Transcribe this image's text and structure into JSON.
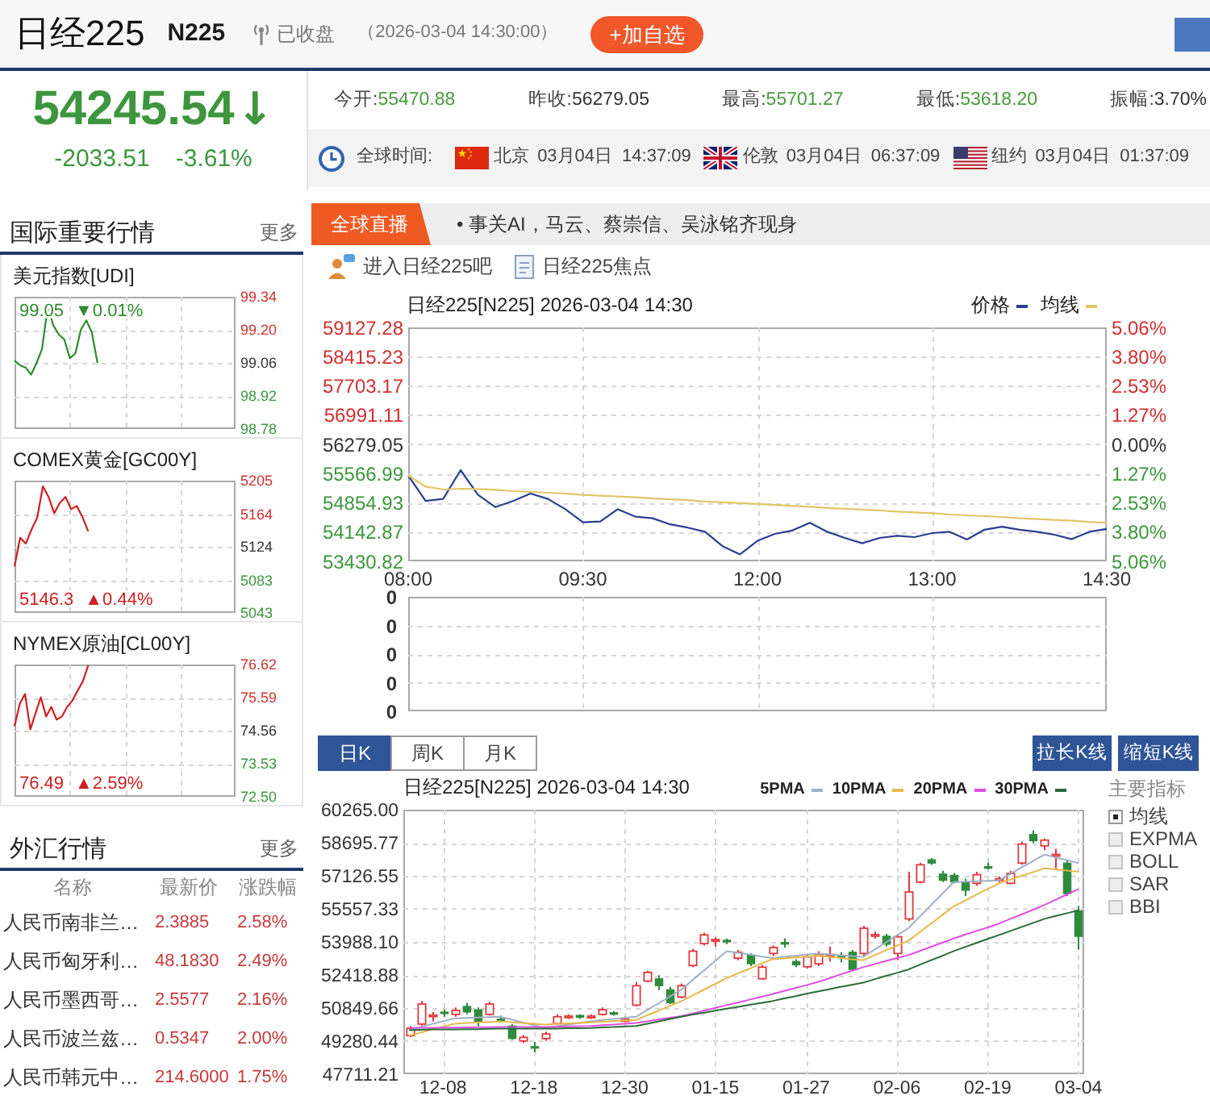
{
  "header": {
    "title": "日经225",
    "code": "N225",
    "status": "已收盘",
    "time": "（2026-03-04 14:30:00）",
    "add_button": "+加自选"
  },
  "quote": {
    "price": "54245.54",
    "arrow": "↓",
    "change": "-2033.51",
    "change_percent": "-3.61%"
  },
  "stats": [
    {
      "label": "今开:",
      "value": "55470.88",
      "color": "#4a9a3e"
    },
    {
      "label": "昨收:",
      "value": "56279.05",
      "color": "#333333"
    },
    {
      "label": "最高:",
      "value": "55701.27",
      "color": "#4a9a3e"
    },
    {
      "label": "最低:",
      "value": "53618.20",
      "color": "#4a9a3e"
    },
    {
      "label": "振幅:",
      "value": "3.70%",
      "color": "#333333"
    }
  ],
  "world_time": {
    "label": "全球时间:",
    "cities": [
      {
        "kind": "cn",
        "city": "北京",
        "date": "03月04日",
        "time": "14:37:09"
      },
      {
        "kind": "gb",
        "city": "伦敦",
        "date": "03月04日",
        "time": "06:37:09"
      },
      {
        "kind": "us",
        "city": "纽约",
        "date": "03月04日",
        "time": "01:37:09"
      }
    ]
  },
  "sidebar": {
    "markets": {
      "title": "国际重要行情",
      "more": "更多",
      "items": [
        {
          "name": "美元指数[UDI]",
          "price": "99.05",
          "change": "▼0.01%",
          "chart_data": {
            "type": "line",
            "grid": true,
            "categories": [
              null,
              null,
              null,
              null,
              null,
              null,
              null,
              null,
              null,
              null,
              null,
              null,
              null,
              null,
              null,
              null,
              null,
              null,
              null,
              null,
              null,
              null,
              null,
              null,
              null,
              null,
              null,
              null,
              null,
              null,
              null,
              null,
              null,
              null,
              null,
              null,
              null,
              null,
              null,
              null,
              null
            ],
            "ylim": [
              98.78,
              99.34
            ],
            "yticks": [
              {
                "value": 99.34,
                "label": "99.34"
              },
              {
                "value": 99.2,
                "label": "99.20"
              },
              {
                "value": 99.06,
                "label": "99.06"
              },
              {
                "value": 98.92,
                "label": "98.92"
              },
              {
                "value": 98.78,
                "label": "98.78"
              }
            ],
            "series": [
              {
                "color": "#2e8b2e",
                "values": [
                  99.07,
                  99.05,
                  99.04,
                  99.01,
                  99.06,
                  99.12,
                  99.3,
                  99.22,
                  99.18,
                  99.16,
                  99.08,
                  99.1,
                  99.2,
                  99.24,
                  99.19,
                  99.06,
                  null,
                  null,
                  null,
                  null,
                  null,
                  null,
                  null,
                  null,
                  null,
                  null,
                  null,
                  null,
                  null,
                  null,
                  null,
                  null,
                  null,
                  null,
                  null,
                  null,
                  null,
                  null,
                  null,
                  null,
                  null
                ]
              }
            ]
          }
        },
        {
          "name": "COMEX黄金[GC00Y]",
          "price": "5146.3",
          "change": "▲0.44%",
          "chart_data": {
            "type": "line",
            "grid": true,
            "categories": [
              null,
              null,
              null,
              null,
              null,
              null,
              null,
              null,
              null,
              null,
              null,
              null,
              null,
              null,
              null,
              null,
              null,
              null,
              null,
              null,
              null,
              null,
              null,
              null,
              null,
              null,
              null,
              null,
              null,
              null,
              null,
              null,
              null,
              null,
              null,
              null,
              null,
              null,
              null,
              null
            ],
            "ylim": [
              5043,
              5205
            ],
            "yticks": [
              {
                "value": 5205,
                "label": "5205"
              },
              {
                "value": 5164,
                "label": "5164"
              },
              {
                "value": 5124,
                "label": "5124"
              },
              {
                "value": 5083,
                "label": "5083"
              },
              {
                "value": 5043,
                "label": "5043"
              }
            ],
            "series": [
              {
                "color": "#cc2020",
                "values": [
                  5100,
                  5135,
                  5128,
                  5145,
                  5160,
                  5198,
                  5185,
                  5165,
                  5178,
                  5185,
                  5170,
                  5174,
                  5160,
                  5143,
                  null,
                  null,
                  null,
                  null,
                  null,
                  null,
                  null,
                  null,
                  null,
                  null,
                  null,
                  null,
                  null,
                  null,
                  null,
                  null,
                  null,
                  null,
                  null,
                  null,
                  null,
                  null,
                  null,
                  null,
                  null,
                  null
                ]
              }
            ]
          }
        },
        {
          "name": "NYMEX原油[CL00Y]",
          "price": "76.49",
          "change": "▲2.59%",
          "chart_data": {
            "type": "line",
            "grid": true,
            "categories": [
              null,
              null,
              null,
              null,
              null,
              null,
              null,
              null,
              null,
              null,
              null,
              null,
              null,
              null,
              null,
              null,
              null,
              null,
              null,
              null,
              null,
              null,
              null,
              null,
              null,
              null,
              null,
              null,
              null,
              null,
              null,
              null,
              null,
              null,
              null,
              null,
              null,
              null,
              null,
              null,
              null,
              null,
              null
            ],
            "ylim": [
              72.5,
              76.62
            ],
            "yticks": [
              {
                "value": 76.62,
                "label": "76.62"
              },
              {
                "value": 75.59,
                "label": "75.59"
              },
              {
                "value": 74.56,
                "label": "74.56"
              },
              {
                "value": 73.53,
                "label": "73.53"
              },
              {
                "value": 72.5,
                "label": "72.50"
              }
            ],
            "series": [
              {
                "color": "#cc2020",
                "values": [
                  74.7,
                  75.4,
                  75.7,
                  74.6,
                  75.1,
                  75.6,
                  75,
                  75.3,
                  74.9,
                  75,
                  75.3,
                  75.5,
                  75.8,
                  76.1,
                  76.6,
                  null,
                  null,
                  null,
                  null,
                  null,
                  null,
                  null,
                  null,
                  null,
                  null,
                  null,
                  null,
                  null,
                  null,
                  null,
                  null,
                  null,
                  null,
                  null,
                  null,
                  null,
                  null,
                  null,
                  null,
                  null,
                  null,
                  null,
                  null
                ]
              }
            ]
          }
        }
      ]
    },
    "forex": {
      "title": "外汇行情",
      "more": "更多",
      "columns": [
        "名称",
        "最新价",
        "涨跌幅"
      ],
      "rows": [
        {
          "name": "人民币南非兰…",
          "price": "2.3885",
          "change": "2.58%"
        },
        {
          "name": "人民币匈牙利…",
          "price": "48.1830",
          "change": "2.49%"
        },
        {
          "name": "人民币墨西哥…",
          "price": "2.5577",
          "change": "2.16%"
        },
        {
          "name": "人民币波兰兹…",
          "price": "0.5347",
          "change": "2.00%"
        },
        {
          "name": "人民币韩元中…",
          "price": "214.6000",
          "change": "1.75%"
        }
      ]
    }
  },
  "main": {
    "news": {
      "tab": "全球直播",
      "headline": "• 事关AI，马云、蔡崇信、吴泳铭齐现身"
    },
    "links": [
      {
        "kind": "forum",
        "label": "进入日经225吧"
      },
      {
        "kind": "focus",
        "label": "日经225焦点"
      }
    ],
    "intraday": {
      "chart_data": {
        "type": "line",
        "title": "日经225[N225] 2026-03-04 14:30",
        "grid": true,
        "legend": "upper right",
        "categories": [
          "08:00",
          null,
          null,
          null,
          null,
          null,
          null,
          null,
          null,
          null,
          "09:30",
          null,
          null,
          null,
          null,
          null,
          null,
          null,
          null,
          null,
          "12:00",
          null,
          null,
          null,
          null,
          null,
          null,
          null,
          null,
          null,
          "13:00",
          null,
          null,
          null,
          null,
          null,
          null,
          null,
          null,
          null,
          "14:30"
        ],
        "ylim": [
          53430.82,
          59127.28
        ],
        "yticks": [
          {
            "value": 59127.28,
            "label": "59127.28"
          },
          {
            "value": 58415.23,
            "label": "58415.23"
          },
          {
            "value": 57703.17,
            "label": "57703.17"
          },
          {
            "value": 56991.11,
            "label": "56991.11"
          },
          {
            "value": 56279.05,
            "label": "56279.05"
          },
          {
            "value": 55566.99,
            "label": "55566.99"
          },
          {
            "value": 54854.93,
            "label": "54854.93"
          },
          {
            "value": 54142.87,
            "label": "54142.87"
          },
          {
            "value": 53430.82,
            "label": "53430.82"
          }
        ],
        "series": [
          {
            "name": "价格",
            "color": "#2b3f8f",
            "values": [
              55520,
              54900,
              54950,
              55650,
              55050,
              54750,
              54900,
              55080,
              54950,
              54700,
              54380,
              54400,
              54700,
              54520,
              54480,
              54330,
              54250,
              54150,
              53800,
              53600,
              53930,
              54100,
              54180,
              54370,
              54150,
              54000,
              53870,
              54000,
              54050,
              54020,
              54120,
              54150,
              53960,
              54200,
              54270,
              54200,
              54150,
              54080,
              53970,
              54150,
              54220
            ]
          },
          {
            "name": "均线",
            "color": "#e3c468",
            "values": [
              55520,
              55250,
              55180,
              55200,
              55190,
              55170,
              55140,
              55120,
              55100,
              55080,
              55050,
              55030,
              55010,
              54990,
              54960,
              54940,
              54920,
              54890,
              54870,
              54850,
              54830,
              54800,
              54780,
              54760,
              54730,
              54710,
              54690,
              54670,
              54640,
              54620,
              54600,
              54570,
              54550,
              54530,
              54510,
              54480,
              54460,
              54440,
              54420,
              54390,
              54370
            ]
          }
        ]
      },
      "percent_labels": [
        "5.06%",
        "3.80%",
        "2.53%",
        "1.27%",
        "0.00%",
        "1.27%",
        "2.53%",
        "3.80%",
        "5.06%"
      ]
    },
    "volume": {
      "y_labels": [
        "0",
        "0",
        "0",
        "0",
        "0"
      ]
    },
    "kline": {
      "tabs": [
        {
          "label": "日K",
          "selected": true
        },
        {
          "label": "周K",
          "selected": false
        },
        {
          "label": "月K",
          "selected": false
        }
      ],
      "buttons": [
        "拉长K线",
        "缩短K线"
      ],
      "chart_data": {
        "type": "candlestick",
        "title": "日经225[N225] 2026-03-04 14:30",
        "grid": true,
        "legend": "upper right",
        "categories": [
          null,
          null,
          null,
          "12-08",
          null,
          null,
          null,
          null,
          null,
          null,
          null,
          "12-18",
          null,
          null,
          null,
          null,
          null,
          null,
          null,
          "12-30",
          null,
          null,
          null,
          null,
          null,
          null,
          null,
          "01-15",
          null,
          null,
          null,
          null,
          null,
          null,
          null,
          "01-27",
          null,
          null,
          null,
          null,
          null,
          null,
          null,
          "02-06",
          null,
          null,
          null,
          null,
          null,
          null,
          null,
          "02-19",
          null,
          null,
          null,
          null,
          null,
          null,
          null,
          "03-04"
        ],
        "ylim": [
          47711.21,
          60265
        ],
        "yticks": [
          {
            "value": 60265,
            "label": "60265.00"
          },
          {
            "value": 58695.77,
            "label": "58695.77"
          },
          {
            "value": 57126.55,
            "label": "57126.55"
          },
          {
            "value": 55557.33,
            "label": "55557.33"
          },
          {
            "value": 53988.1,
            "label": "53988.10"
          },
          {
            "value": 52418.88,
            "label": "52418.88"
          },
          {
            "value": 50849.66,
            "label": "50849.66"
          },
          {
            "value": 49280.44,
            "label": "49280.44"
          },
          {
            "value": 47711.21,
            "label": "47711.21"
          }
        ],
        "ohlc": [
          [
            49540,
            50000,
            49460,
            49890
          ],
          [
            50090,
            51180,
            50000,
            51040
          ],
          [
            50470,
            50660,
            50220,
            50520
          ],
          [
            50660,
            50770,
            50440,
            50600
          ],
          [
            50550,
            50880,
            50440,
            50740
          ],
          [
            50930,
            51100,
            50550,
            50660
          ],
          [
            50770,
            50880,
            50000,
            50220
          ],
          [
            50550,
            51150,
            50500,
            51040
          ],
          [
            50330,
            50500,
            50170,
            50280
          ],
          [
            50000,
            50090,
            49350,
            49400
          ],
          [
            49290,
            49570,
            49190,
            49460
          ],
          [
            49020,
            49240,
            48750,
            48970
          ],
          [
            49400,
            49730,
            49290,
            49620
          ],
          [
            50110,
            50550,
            50060,
            50440
          ],
          [
            50410,
            50550,
            50330,
            50470
          ],
          [
            50500,
            50550,
            50330,
            50410
          ],
          [
            50410,
            50550,
            50330,
            50470
          ],
          [
            50550,
            50880,
            50500,
            50770
          ],
          [
            50630,
            50710,
            50500,
            50550
          ],
          [
            50220,
            50440,
            50170,
            50330
          ],
          [
            50990,
            52080,
            50930,
            51910
          ],
          [
            52130,
            52620,
            52080,
            52540
          ],
          [
            52240,
            52410,
            51700,
            51910
          ],
          [
            51720,
            51860,
            51040,
            51100
          ],
          [
            51370,
            52020,
            51310,
            51910
          ],
          [
            52870,
            53660,
            52790,
            53550
          ],
          [
            53910,
            54430,
            53820,
            54320
          ],
          [
            54040,
            54210,
            53770,
            54100
          ],
          [
            54070,
            54150,
            53880,
            53990
          ],
          [
            53220,
            53610,
            53120,
            53500
          ],
          [
            53360,
            53440,
            52840,
            52950
          ],
          [
            52240,
            52900,
            52190,
            52790
          ],
          [
            53440,
            53820,
            53330,
            53720
          ],
          [
            53960,
            54150,
            53720,
            53910
          ],
          [
            53060,
            53170,
            52790,
            52900
          ],
          [
            52810,
            53390,
            52730,
            53280
          ],
          [
            52950,
            53550,
            52840,
            53390
          ],
          [
            53330,
            53770,
            53060,
            53390
          ],
          [
            53330,
            53500,
            53010,
            53280
          ],
          [
            53500,
            53610,
            52620,
            52680
          ],
          [
            53440,
            54750,
            53330,
            54640
          ],
          [
            54290,
            54480,
            54150,
            54340
          ],
          [
            54260,
            54370,
            53770,
            53880
          ],
          [
            53440,
            54320,
            53120,
            54230
          ],
          [
            55080,
            57320,
            54970,
            56360
          ],
          [
            56830,
            57750,
            56770,
            57650
          ],
          [
            57890,
            57970,
            57650,
            57730
          ],
          [
            57210,
            57370,
            56830,
            56910
          ],
          [
            57150,
            57260,
            56770,
            56830
          ],
          [
            56830,
            56990,
            56170,
            56440
          ],
          [
            56770,
            57320,
            56660,
            57180
          ],
          [
            57560,
            57750,
            57430,
            57510
          ],
          [
            56910,
            57100,
            56830,
            56990
          ],
          [
            56770,
            57370,
            56720,
            57240
          ],
          [
            57730,
            58740,
            57650,
            58630
          ],
          [
            59090,
            59280,
            58680,
            58790
          ],
          [
            58550,
            58900,
            58350,
            58820
          ],
          [
            58080,
            58410,
            57450,
            58140
          ],
          [
            57730,
            57860,
            56170,
            56280
          ],
          [
            55470,
            55700,
            53620,
            54250
          ]
        ],
        "series": [
          {
            "name": "5PMA",
            "type": "line",
            "color": "#9fb0c4",
            "values": [
              49810,
              49950,
              50090,
              50220,
              50360,
              50380,
              50400,
              50420,
              50440,
              50310,
              50170,
              50040,
              49900,
              49980,
              50060,
              50140,
              50220,
              50280,
              50330,
              50390,
              50440,
              50760,
              51080,
              51400,
              51720,
              52180,
              52640,
              53090,
              53550,
              53470,
              53390,
              53300,
              53220,
              53280,
              53330,
              53390,
              53440,
              53400,
              53360,
              53320,
              53280,
              53620,
              53960,
              54300,
              54640,
              55190,
              55740,
              56280,
              56830,
              56850,
              56870,
              56890,
              56910,
              57220,
              57530,
              57830,
              58140,
              58000,
              57870,
              57730
            ]
          },
          {
            "name": "10PMA",
            "type": "line",
            "color": "#e6b84a",
            "values": [
              49540,
              49680,
              49830,
              49970,
              50110,
              50140,
              50170,
              50190,
              50220,
              50180,
              50140,
              50100,
              50060,
              50090,
              50120,
              50140,
              50170,
              50200,
              50230,
              50250,
              50280,
              50510,
              50730,
              50960,
              51180,
              51450,
              51730,
              52000,
              52270,
              52500,
              52720,
              52950,
              53170,
              53210,
              53250,
              53290,
              53330,
              53280,
              53230,
              53170,
              53120,
              53350,
              53580,
              53810,
              54040,
              54450,
              54860,
              55270,
              55680,
              55950,
              56230,
              56500,
              56770,
              56950,
              57130,
              57300,
              57480,
              57430,
              57370,
              57320
            ]
          },
          {
            "name": "20PMA",
            "type": "line",
            "color": "#e04ee0",
            "values": [
              49900,
              49910,
              49910,
              49920,
              49920,
              49930,
              49940,
              49940,
              49950,
              49950,
              49950,
              49950,
              49950,
              49960,
              49980,
              49990,
              50000,
              50040,
              50070,
              50110,
              50140,
              50220,
              50310,
              50390,
              50470,
              50600,
              50730,
              50860,
              50990,
              51120,
              51250,
              51380,
              51510,
              51650,
              51800,
              51940,
              52080,
              52260,
              52440,
              52610,
              52790,
              52930,
              53080,
              53220,
              53360,
              53560,
              53760,
              53950,
              54150,
              54330,
              54510,
              54680,
              54860,
              55080,
              55300,
              55520,
              55740,
              55990,
              56250,
              56500
            ]
          },
          {
            "name": "30PMA",
            "type": "line",
            "color": "#2b6b3a",
            "values": [
              49810,
              49820,
              49830,
              49830,
              49840,
              49850,
              49850,
              49860,
              49870,
              49870,
              49870,
              49870,
              49870,
              49880,
              49890,
              49890,
              49900,
              49930,
              49950,
              49980,
              50000,
              50110,
              50220,
              50330,
              50440,
              50540,
              50630,
              50730,
              50820,
              50910,
              51000,
              51090,
              51180,
              51300,
              51410,
              51530,
              51640,
              51740,
              51850,
              51950,
              52050,
              52210,
              52370,
              52520,
              52680,
              52900,
              53120,
              53330,
              53550,
              53740,
              53940,
              54130,
              54320,
              54510,
              54700,
              54890,
              55080,
              55220,
              55350,
              55490
            ]
          }
        ]
      },
      "indicators": {
        "title": "主要指标",
        "items": [
          {
            "label": "均线",
            "checked": true
          },
          {
            "label": "EXPMA",
            "checked": false
          },
          {
            "label": "BOLL",
            "checked": false
          },
          {
            "label": "SAR",
            "checked": false
          },
          {
            "label": "BBI",
            "checked": false
          }
        ]
      }
    }
  }
}
